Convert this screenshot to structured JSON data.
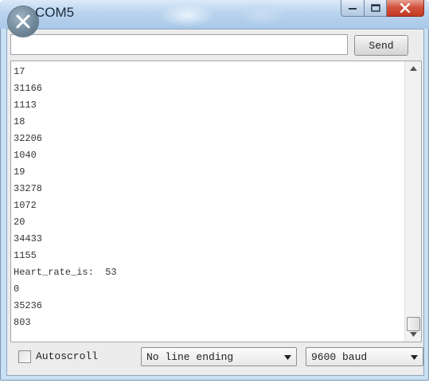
{
  "window": {
    "title": "COM5",
    "controls": {
      "minimize_icon": "minimize-icon",
      "maximize_icon": "maximize-icon",
      "close_icon": "close-icon"
    }
  },
  "send": {
    "input_value": "",
    "button_label": "Send"
  },
  "output": {
    "lines": [
      "17",
      "31166",
      "1113",
      "18",
      "32206",
      "1040",
      "19",
      "33278",
      "1072",
      "20",
      "34433",
      "1155",
      "Heart_rate_is:  53",
      "0",
      "35236",
      "803"
    ]
  },
  "footer": {
    "autoscroll_label": "Autoscroll",
    "autoscroll_checked": false,
    "line_ending_selected": "No line ending",
    "baud_selected": "9600 baud"
  },
  "colors": {
    "title_bar": "#b9d3ee",
    "close_button": "#d2543e",
    "client_bg": "#ececec"
  }
}
